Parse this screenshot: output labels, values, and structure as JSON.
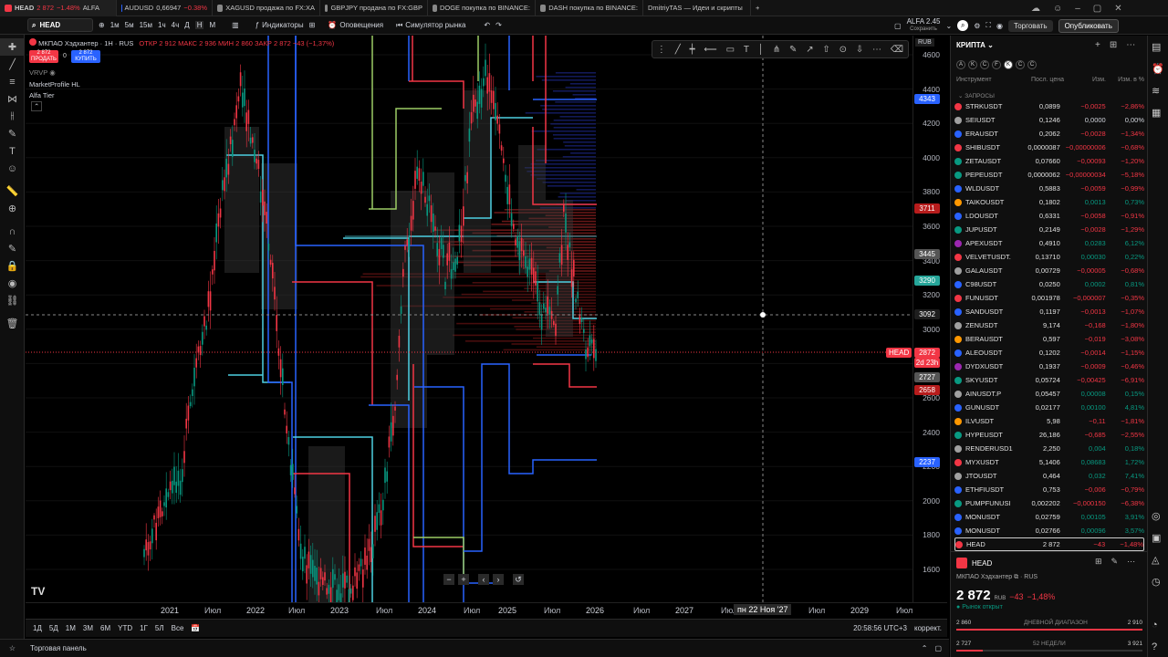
{
  "tabs": [
    {
      "label": "HEAD",
      "price": "2 872",
      "change": "−1.48%",
      "extra": "ALFA"
    },
    {
      "label": "AUDUSD",
      "price": "0,66947",
      "change": "−0.38%"
    },
    {
      "label": "XAGUSD продажа по FX:XA"
    },
    {
      "label": "GBPJPY продана по FX:GBP"
    },
    {
      "label": "DOGE покупка по BINANCE:"
    },
    {
      "label": "DASH покупка по BINANCE:"
    },
    {
      "label": "DmitriyTAS — Идеи и скрипты"
    }
  ],
  "toolbar": {
    "symbol": "HEAD",
    "intervals": [
      "1м",
      "5м",
      "15м",
      "1ч",
      "4ч",
      "Д",
      "Н",
      "М"
    ],
    "indicators": "Индикаторы",
    "alerts": "Оповещения",
    "replay": "Симулятор рынка",
    "account": "ALFA 2.45",
    "account_sub": "Сохранить",
    "trade": "Торговать",
    "publish": "Опубликовать"
  },
  "legend": {
    "title": "МКПАО Хэдхантер · 1Н · RUS",
    "ohlc": "ОТКР 2 912  МАКС 2 936  МИН 2 860  ЗАКР 2 872  −43 (−1,37%)",
    "sell_price": "2 872",
    "sell_label": "ПРОДАТЬ",
    "spread": "0",
    "buy_price": "2 872",
    "buy_label": "КУПИТЬ",
    "vol": "VRVP",
    "ind1": "MarketProfile HL",
    "ind2": "Alfa Tier"
  },
  "price_axis": {
    "currency": "RUB",
    "ticks": [
      "4600",
      "4400",
      "4200",
      "4000",
      "3800",
      "3600",
      "3400",
      "3200",
      "3000",
      "2800",
      "2600",
      "2400",
      "2200",
      "2000",
      "1800",
      "1600"
    ],
    "labels": [
      {
        "text": "4343",
        "color": "#2962ff"
      },
      {
        "text": "3711",
        "color": "#b71c1c"
      },
      {
        "text": "3445",
        "color": "#555555"
      },
      {
        "text": "3290",
        "color": "#26a69a"
      },
      {
        "text": "3092",
        "color": "#1e1e1e"
      },
      {
        "text": "2872",
        "color": "#f23645"
      },
      {
        "text": "2d 23h",
        "color": "#f23645"
      },
      {
        "text": "2727",
        "color": "#555555"
      },
      {
        "text": "2658",
        "color": "#b71c1c"
      },
      {
        "text": "2237",
        "color": "#2962ff"
      }
    ],
    "head_tag": "HEAD"
  },
  "time_axis": {
    "ticks": [
      "2021",
      "Июл",
      "2022",
      "Июл",
      "2023",
      "Июл",
      "2024",
      "Июл",
      "2025",
      "Июл",
      "2026",
      "Июл",
      "2027",
      "Июл",
      "2028",
      "Июл",
      "2029",
      "Июл"
    ],
    "crosshair": "пн 22 Ноя '27"
  },
  "bottom": {
    "ranges": [
      "1Д",
      "5Д",
      "1М",
      "3М",
      "6М",
      "YTD",
      "1Г",
      "5Л",
      "Все"
    ],
    "clock": "20:58:56 UTC+3",
    "adj": "коррект."
  },
  "footer": {
    "panel": "Торговая панель"
  },
  "watchlist": {
    "title": "КРИПТА",
    "letters": [
      "A",
      "K",
      "C",
      "F",
      "K",
      "C",
      "C"
    ],
    "cols": [
      "Инструмент",
      "Посл. цена",
      "Изм.",
      "Изм. в %"
    ],
    "section": "ЗАПРОСЫ",
    "rows": [
      {
        "sym": "STRKUSDT",
        "last": "0,0899",
        "chg": "−0,0025",
        "pct": "−2,86%",
        "c": "#f23645"
      },
      {
        "sym": "SEIUSDT",
        "last": "0,1246",
        "chg": "0,0000",
        "pct": "0,00%",
        "c": "#a0a0a0"
      },
      {
        "sym": "ERAUSDT",
        "last": "0,2062",
        "chg": "−0,0028",
        "pct": "−1,34%",
        "c": "#2962ff"
      },
      {
        "sym": "SHIBUSDT",
        "last": "0,0000087",
        "chg": "−0,00000006",
        "pct": "−0,68%",
        "c": "#f23645"
      },
      {
        "sym": "ZETAUSDT",
        "last": "0,07660",
        "chg": "−0,00093",
        "pct": "−1,20%",
        "c": "#089981"
      },
      {
        "sym": "PEPEUSDT",
        "last": "0,0000062",
        "chg": "−0,00000034",
        "pct": "−5,18%",
        "c": "#089981"
      },
      {
        "sym": "WLDUSDT",
        "last": "0,5883",
        "chg": "−0,0059",
        "pct": "−0,99%",
        "c": "#2962ff"
      },
      {
        "sym": "TAIKOUSDT",
        "last": "0,1802",
        "chg": "0,0013",
        "pct": "0,73%",
        "c": "#ff9800"
      },
      {
        "sym": "LDOUSDT",
        "last": "0,6331",
        "chg": "−0,0058",
        "pct": "−0,91%",
        "c": "#2962ff"
      },
      {
        "sym": "JUPUSDT",
        "last": "0,2149",
        "chg": "−0,0028",
        "pct": "−1,29%",
        "c": "#089981"
      },
      {
        "sym": "APEXUSDT",
        "last": "0,4910",
        "chg": "0,0283",
        "pct": "6,12%",
        "c": "#9c27b0"
      },
      {
        "sym": "VELVETUSDT.",
        "last": "0,13710",
        "chg": "0,00030",
        "pct": "0,22%",
        "c": "#f23645"
      },
      {
        "sym": "GALAUSDT",
        "last": "0,00729",
        "chg": "−0,00005",
        "pct": "−0,68%",
        "c": "#a0a0a0"
      },
      {
        "sym": "C98USDT",
        "last": "0,0250",
        "chg": "0,0002",
        "pct": "0,81%",
        "c": "#2962ff"
      },
      {
        "sym": "FUNUSDT",
        "last": "0,001978",
        "chg": "−0,000007",
        "pct": "−0,35%",
        "c": "#f23645"
      },
      {
        "sym": "SANDUSDT",
        "last": "0,1197",
        "chg": "−0,0013",
        "pct": "−1,07%",
        "c": "#2962ff"
      },
      {
        "sym": "ZENUSDT",
        "last": "9,174",
        "chg": "−0,168",
        "pct": "−1,80%",
        "c": "#a0a0a0"
      },
      {
        "sym": "BERAUSDT",
        "last": "0,597",
        "chg": "−0,019",
        "pct": "−3,08%",
        "c": "#ff9800"
      },
      {
        "sym": "ALEOUSDT",
        "last": "0,1202",
        "chg": "−0,0014",
        "pct": "−1,15%",
        "c": "#2962ff"
      },
      {
        "sym": "DYDXUSDT",
        "last": "0,1937",
        "chg": "−0,0009",
        "pct": "−0,46%",
        "c": "#9c27b0"
      },
      {
        "sym": "SKYUSDT",
        "last": "0,05724",
        "chg": "−0,00425",
        "pct": "−6,91%",
        "c": "#089981"
      },
      {
        "sym": "AINUSDT.P",
        "last": "0,05457",
        "chg": "0,00008",
        "pct": "0,15%",
        "c": "#a0a0a0"
      },
      {
        "sym": "GUNUSDT",
        "last": "0,02177",
        "chg": "0,00100",
        "pct": "4,81%",
        "c": "#2962ff"
      },
      {
        "sym": "ILVUSDT",
        "last": "5,98",
        "chg": "−0,11",
        "pct": "−1,81%",
        "c": "#ff9800"
      },
      {
        "sym": "HYPEUSDT",
        "last": "26,186",
        "chg": "−0,685",
        "pct": "−2,55%",
        "c": "#089981"
      },
      {
        "sym": "RENDERUSD1",
        "last": "2,250",
        "chg": "0,004",
        "pct": "0,18%",
        "c": "#a0a0a0"
      },
      {
        "sym": "MYXUSDT",
        "last": "5,1406",
        "chg": "0,08683",
        "pct": "1,72%",
        "c": "#f23645"
      },
      {
        "sym": "JTOUSDT",
        "last": "0,464",
        "chg": "0,032",
        "pct": "7,41%",
        "c": "#a0a0a0"
      },
      {
        "sym": "ETHFIUSDT",
        "last": "0,753",
        "chg": "−0,006",
        "pct": "−0,79%",
        "c": "#2962ff"
      },
      {
        "sym": "PUMPFUNUSI",
        "last": "0,002202",
        "chg": "−0,000150",
        "pct": "−6,38%",
        "c": "#089981"
      },
      {
        "sym": "MONUSDT",
        "last": "0,02759",
        "chg": "0,00105",
        "pct": "3,91%",
        "c": "#2962ff"
      },
      {
        "sym": "MONUSDT",
        "last": "0,02766",
        "chg": "0,00096",
        "pct": "3,57%",
        "c": "#2962ff"
      },
      {
        "sym": "HEAD",
        "last": "2 872",
        "chg": "−43",
        "pct": "−1,48%",
        "c": "#f23645"
      }
    ]
  },
  "details": {
    "symbol": "HEAD",
    "name": "МКПАО Хэдхантер",
    "exchange": "RUS",
    "price": "2 872",
    "currency": "RUB",
    "change": "−43",
    "change_pct": "−1,48%",
    "status": "Рынок открыт",
    "day_low": "2 860",
    "day_label": "ДНЕВНОЙ ДИАПАЗОН",
    "day_high": "2 910",
    "wk_low": "2 727",
    "wk_label": "52 НЕДЕЛИ",
    "wk_high": "3 921"
  },
  "icons": {
    "cross": "cursor-cross-icon",
    "trend": "trend-line-icon",
    "fib": "fib-icon",
    "brush": "brush-icon",
    "text": "text-icon",
    "ruler": "ruler-icon",
    "zoom": "zoom-icon",
    "magnet": "magnet-icon",
    "lock": "lock-icon",
    "trash": "trash-icon"
  },
  "colors": {
    "red": "#f23645",
    "green": "#089981",
    "blue": "#2962ff",
    "teal": "#4dd0e1",
    "lime": "#9ccc65"
  }
}
